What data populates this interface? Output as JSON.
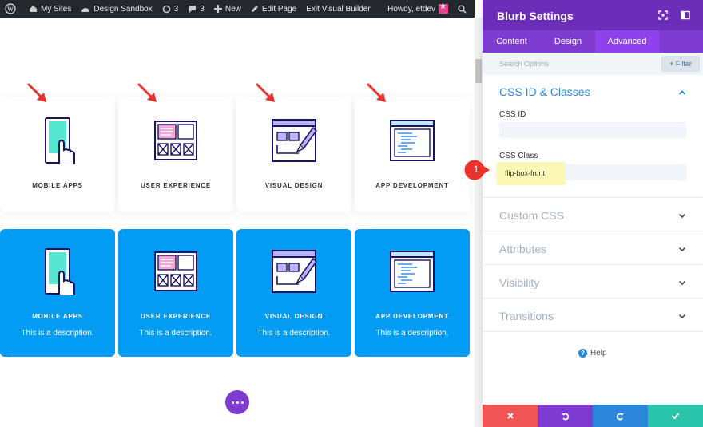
{
  "admin_bar": {
    "my_sites": "My Sites",
    "site_name": "Design Sandbox",
    "updates_count": "3",
    "comments_count": "3",
    "new_label": "New",
    "edit_page": "Edit Page",
    "exit_builder": "Exit Visual Builder",
    "howdy": "Howdy, etdev"
  },
  "canvas": {
    "white_cards": [
      {
        "title": "MOBILE APPS",
        "icon": "mobile-hand-icon"
      },
      {
        "title": "USER EXPERIENCE",
        "icon": "wireframe-icon"
      },
      {
        "title": "VISUAL DESIGN",
        "icon": "design-pencil-icon"
      },
      {
        "title": "APP DEVELOPMENT",
        "icon": "code-window-icon"
      }
    ],
    "blue_cards": [
      {
        "title": "MOBILE APPS",
        "description": "This is a description."
      },
      {
        "title": "USER EXPERIENCE",
        "description": "This is a description."
      },
      {
        "title": "VISUAL DESIGN",
        "description": "This is a description."
      },
      {
        "title": "APP DEVELOPMENT",
        "description": "This is a description."
      }
    ],
    "accent_blue": "#039cf4"
  },
  "panel": {
    "title": "Blurb Settings",
    "tabs": [
      {
        "label": "Content"
      },
      {
        "label": "Design"
      },
      {
        "label": "Advanced",
        "active": true
      }
    ],
    "search_placeholder": "Search Options",
    "filter_label": "+ Filter",
    "open_section": {
      "title": "CSS ID & Classes",
      "css_id_label": "CSS ID",
      "css_id_value": "",
      "css_class_label": "CSS Class",
      "css_class_value": "flip-box-front",
      "callout_number": "1"
    },
    "closed_sections": [
      "Custom CSS",
      "Attributes",
      "Visibility",
      "Transitions"
    ],
    "help_label": "Help",
    "footer_colors": {
      "discard": "#ef5555",
      "undo": "#7e3bd0",
      "redo": "#2b87da",
      "save": "#29c4a9"
    },
    "header_color": "#6c2eb9"
  }
}
